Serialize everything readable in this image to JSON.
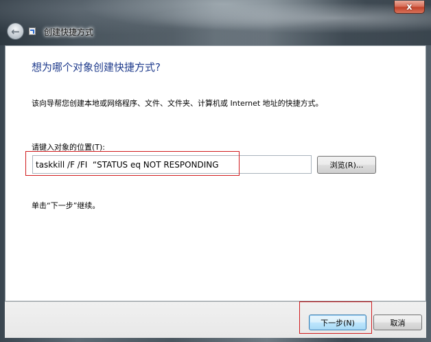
{
  "window": {
    "title": "创建快捷方式",
    "close_glyph": "x"
  },
  "back": {
    "glyph": "←",
    "icon": "back-arrow-icon"
  },
  "content": {
    "heading": "想为哪个对象创建快捷方式?",
    "description": "该向导帮您创建本地或网络程序、文件、文件夹、计算机或 Internet 地址的快捷方式。",
    "location_label": "请键入对象的位置(T):",
    "location_value": "taskkill /F /FI  “STATUS eq NOT RESPONDING",
    "browse_label": "浏览(R)...",
    "hint": "单击“下一步”继续。"
  },
  "footer": {
    "next_label": "下一步(N)",
    "cancel_label": "取消"
  },
  "colors": {
    "heading": "#1f3b8c",
    "highlight_box": "#d0191c"
  }
}
